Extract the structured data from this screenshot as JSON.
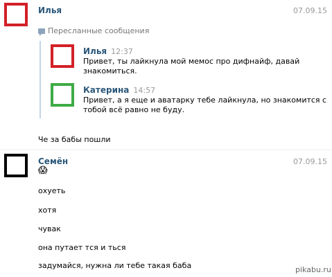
{
  "message1": {
    "author": "Илья",
    "date": "07.09.15",
    "avatar_color": "#d32027",
    "forwarded_label": "Пересланные сообщения",
    "forwarded": [
      {
        "author": "Илья",
        "time": "12:37",
        "avatar_color": "#d32027",
        "line1": "Привет, ты лайкнула мой мемос про дифнайф, давай",
        "line2": "знакомиться."
      },
      {
        "author": "Катерина",
        "time": "14:57",
        "avatar_color": "#3eab45",
        "line1": "Привет, а я еще и аватарку тебе лайкнула, но знакомится с",
        "line2": "тобой всё равно не буду."
      }
    ],
    "text": "Че за бабы пошли"
  },
  "message2": {
    "author": "Семён",
    "date": "07.09.15",
    "avatar_color": "#000000",
    "emoji": "😱",
    "lines": [
      "охуеть",
      "хотя",
      "чувак",
      "она путает тся и ться",
      "задумайся, нужна ли тебе такая баба"
    ]
  },
  "watermark": "pikabu.ru",
  "colors": {
    "link_blue": "#2b587a",
    "muted_gray": "#999999",
    "quote_line": "#c5d5e4"
  }
}
